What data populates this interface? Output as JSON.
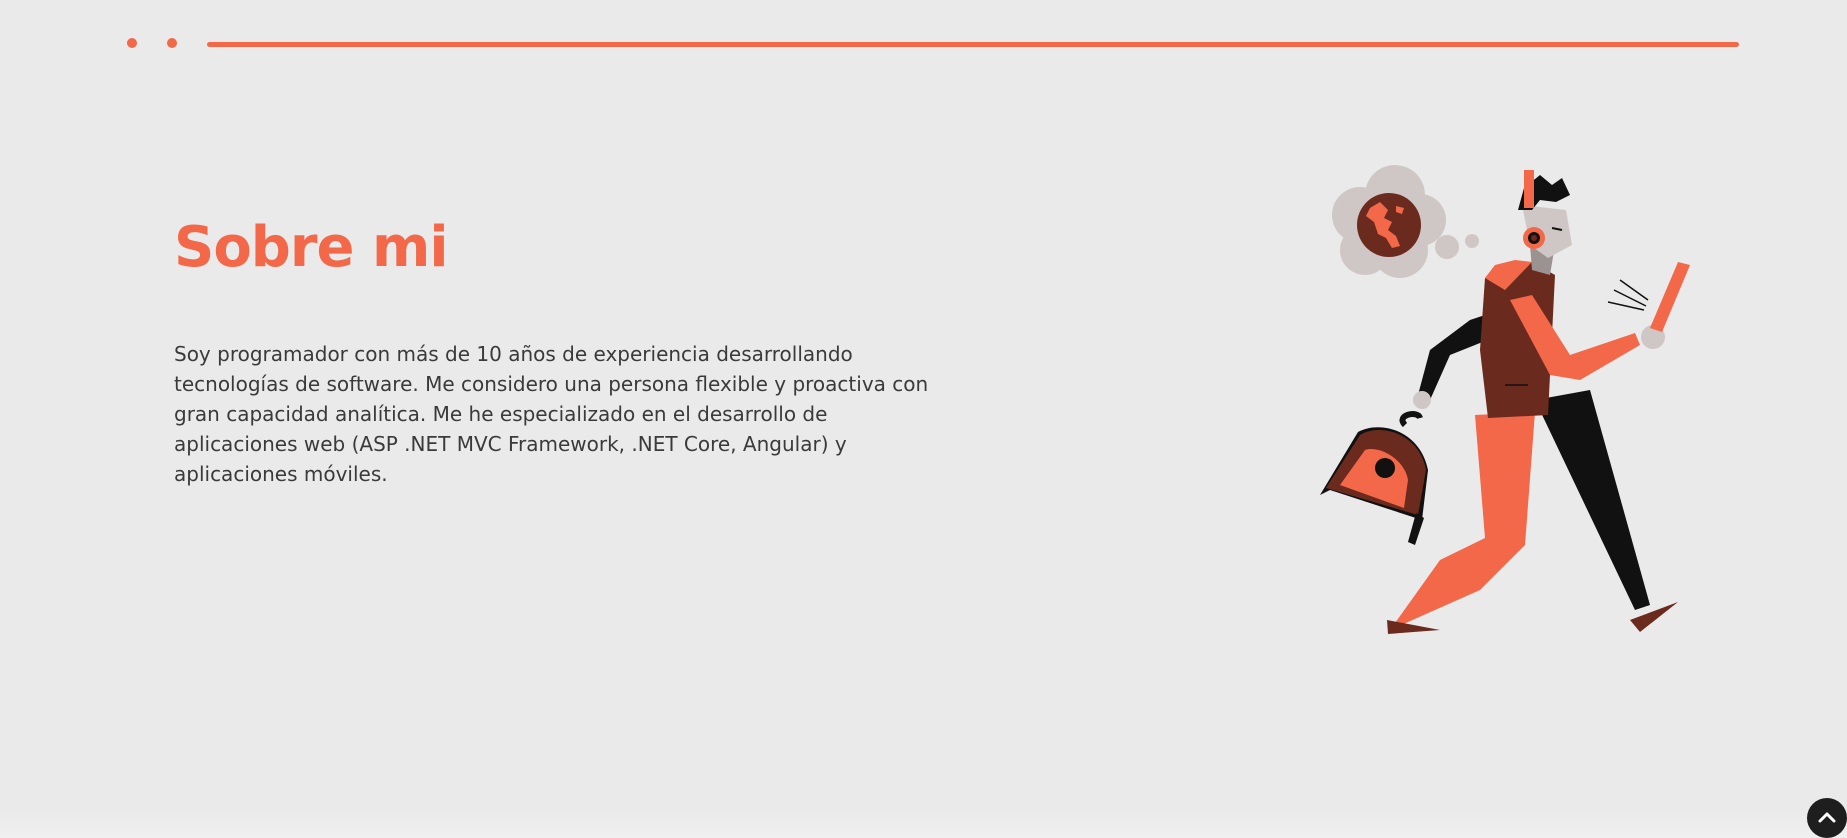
{
  "header": {
    "decoration": "dots-and-line",
    "accent_color": "#f26849"
  },
  "about": {
    "title": "Sobre mi",
    "description": "Soy programador con más de 10 años de experiencia desarrollando tecnologías de software. Me considero una persona flexible y proactiva con gran capacidad analítica. Me he especializado en el desarrollo de aplicaciones web (ASP .NET MVC Framework, .NET Core, Angular) y aplicaciones móviles.",
    "illustration": "man-walking-with-phone-and-backpack-illustration"
  },
  "scroll_top": {
    "icon": "chevron-up-icon"
  },
  "colors": {
    "accent": "#f26849",
    "dark_brown": "#6b2a1e",
    "background": "#eaeaea",
    "text": "#3a3a3a"
  }
}
